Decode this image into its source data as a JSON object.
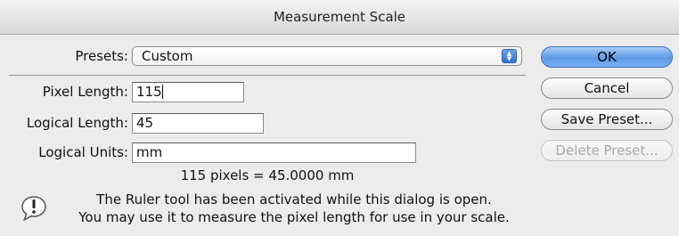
{
  "window": {
    "title": "Measurement Scale"
  },
  "presets": {
    "label": "Presets:",
    "value": "Custom"
  },
  "fields": {
    "pixel_length": {
      "label": "Pixel Length:",
      "value": "115"
    },
    "logical_length": {
      "label": "Logical Length:",
      "value": "45"
    },
    "logical_units": {
      "label": "Logical Units:",
      "value": "mm"
    }
  },
  "summary": "115 pixels = 45.0000 mm",
  "message": {
    "line1": "The Ruler tool has been activated while this dialog is open.",
    "line2": "You may use it to measure the pixel length for use in your scale."
  },
  "buttons": {
    "ok": "OK",
    "cancel": "Cancel",
    "save_preset": "Save Preset...",
    "delete_preset": "Delete Preset..."
  },
  "colors": {
    "default_button": "#5e9ae6",
    "disabled_text": "#a8a8a8"
  },
  "icons": {
    "alert": "exclamation-alert-icon",
    "popup": "up-down-arrows-icon"
  }
}
